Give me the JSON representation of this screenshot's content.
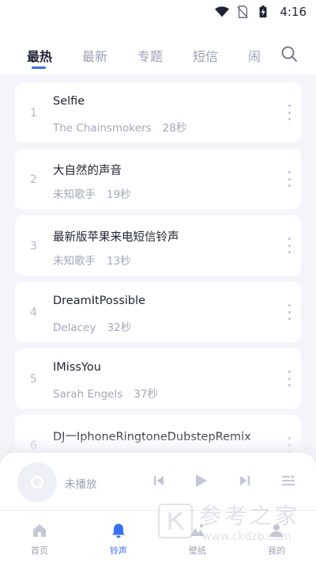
{
  "status_bar": {
    "time": "4:16",
    "icons": [
      "wifi-icon",
      "sim-off-icon",
      "battery-charging-icon"
    ]
  },
  "tabs": [
    {
      "label": "最热",
      "active": true
    },
    {
      "label": "最新",
      "active": false
    },
    {
      "label": "专题",
      "active": false
    },
    {
      "label": "短信",
      "active": false
    },
    {
      "label": "闹",
      "active": false
    }
  ],
  "songs": [
    {
      "index": "1",
      "title": "Selfie",
      "artist": "The Chainsmokers",
      "duration": "28秒"
    },
    {
      "index": "2",
      "title": "大自然的声音",
      "artist": "未知歌手",
      "duration": "19秒"
    },
    {
      "index": "3",
      "title": "最新版苹果来电短信铃声",
      "artist": "未知歌手",
      "duration": "13秒"
    },
    {
      "index": "4",
      "title": "DreamItPossible",
      "artist": "Delacey",
      "duration": "32秒"
    },
    {
      "index": "5",
      "title": "IMissYou",
      "artist": "Sarah Engels",
      "duration": "37秒"
    },
    {
      "index": "6",
      "title": "DJ一IphoneRingtoneDubstepRemix",
      "artist": "",
      "duration": ""
    }
  ],
  "player": {
    "status": "未播放"
  },
  "nav": [
    {
      "label": "首页",
      "icon": "home-icon",
      "active": false
    },
    {
      "label": "铃声",
      "icon": "bell-icon",
      "active": true
    },
    {
      "label": "壁纸",
      "icon": "wallpaper-icon",
      "active": false
    },
    {
      "label": "我的",
      "icon": "user-icon",
      "active": false
    }
  ],
  "colors": {
    "accent": "#3a6ff7",
    "background": "#f4f5fa",
    "muted": "#9da1b5"
  },
  "watermark": {
    "text": "参考之家",
    "url": "www.ckdzb.com",
    "logo_letter": "K"
  }
}
